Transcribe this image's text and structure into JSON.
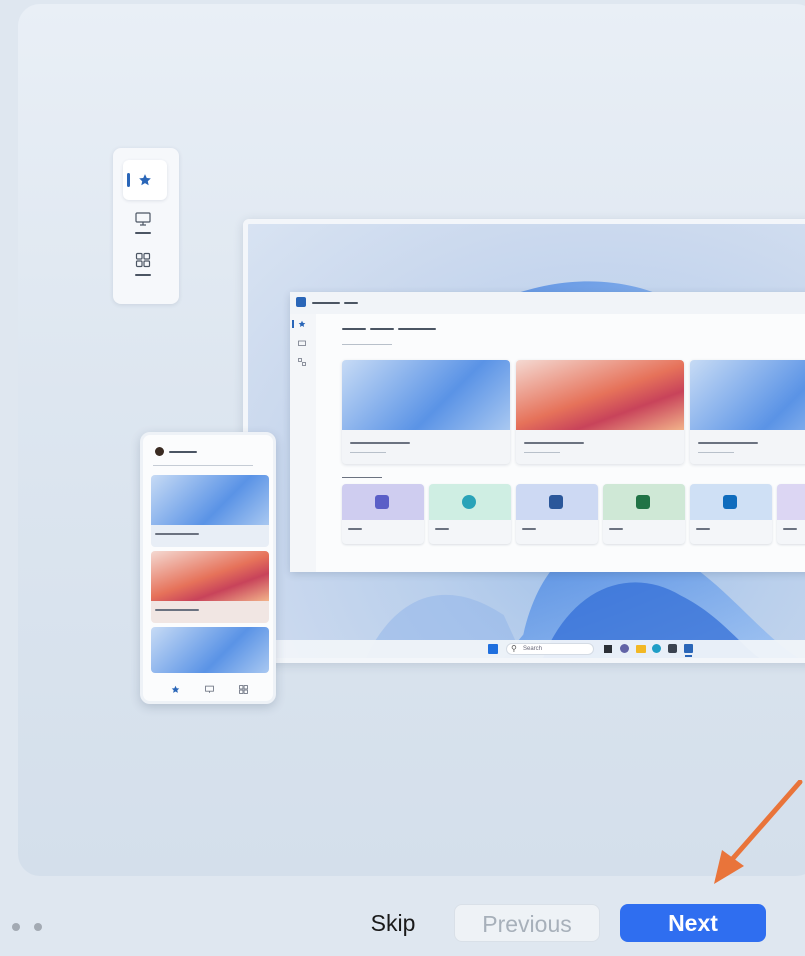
{
  "taskbar": {
    "search_label": "Search"
  },
  "footer": {
    "skip_label": "Skip",
    "previous_label": "Previous",
    "next_label": "Next",
    "page_count": 2,
    "previous_enabled": false
  },
  "icons": {
    "rail": [
      "star-icon",
      "monitor-icon",
      "apps-icon"
    ],
    "phone_nav": [
      "star-icon",
      "monitor-icon",
      "apps-icon"
    ],
    "app_tiles": [
      "teams-icon",
      "edge-icon",
      "word-icon",
      "excel-icon",
      "outlook-icon"
    ]
  },
  "colors": {
    "accent": "#2f6ef0",
    "rail_active": "#2a66b8",
    "annotation_arrow": "#e9743a",
    "disabled_text": "#a7b0ba"
  }
}
